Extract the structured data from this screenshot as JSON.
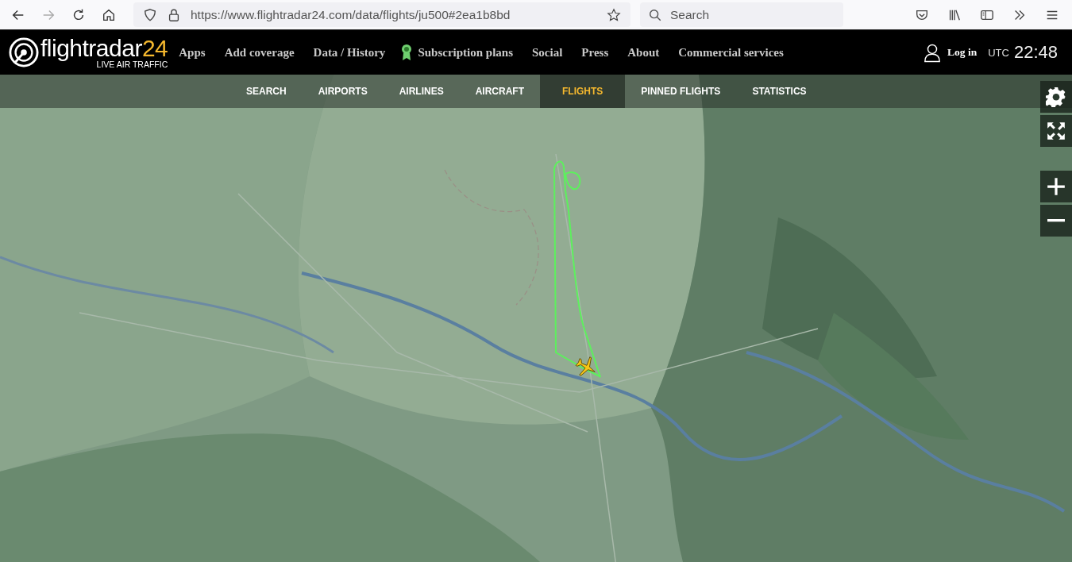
{
  "browser": {
    "url": "https://www.flightradar24.com/data/flights/ju500#2ea1b8bd",
    "search_placeholder": "Search"
  },
  "header": {
    "logo": {
      "name": "flightradar",
      "accent": "24",
      "tagline": "LIVE AIR TRAFFIC"
    },
    "nav": [
      {
        "label": "Apps",
        "kind": "link"
      },
      {
        "label": "Add coverage",
        "kind": "link"
      },
      {
        "label": "Data / History",
        "kind": "link"
      },
      {
        "label": "Subscription plans",
        "kind": "award"
      },
      {
        "label": "Social",
        "kind": "link"
      },
      {
        "label": "Press",
        "kind": "link"
      },
      {
        "label": "About",
        "kind": "link"
      },
      {
        "label": "Commercial services",
        "kind": "link"
      }
    ],
    "login": "Log in",
    "utc": "UTC",
    "time": "22:48"
  },
  "subnav": [
    {
      "label": "SEARCH",
      "selected": false
    },
    {
      "label": "AIRPORTS",
      "selected": false
    },
    {
      "label": "AIRLINES",
      "selected": false
    },
    {
      "label": "AIRCRAFT",
      "selected": false
    },
    {
      "label": "FLIGHTS",
      "selected": true
    },
    {
      "label": "PINNED FLIGHTS",
      "selected": false
    },
    {
      "label": "STATISTICS",
      "selected": false
    }
  ]
}
